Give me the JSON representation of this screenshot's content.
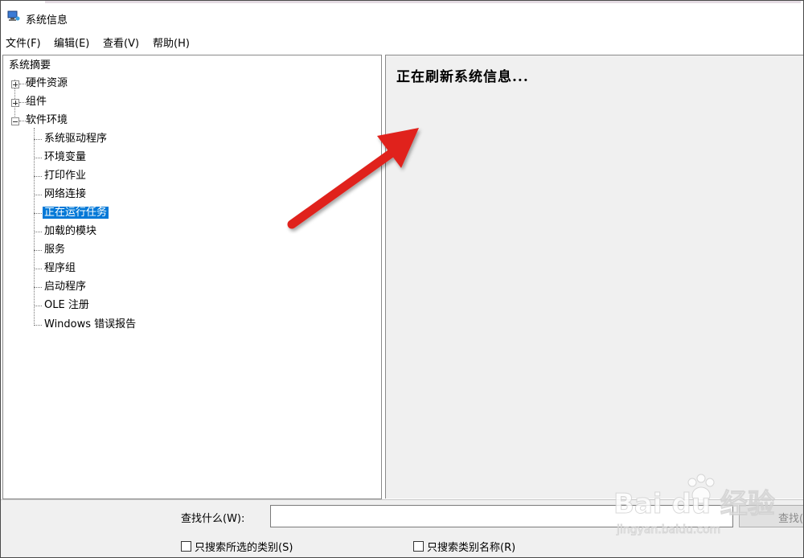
{
  "window": {
    "title": "系统信息"
  },
  "menu": [
    "文件(F)",
    "编辑(E)",
    "查看(V)",
    "帮助(H)"
  ],
  "tree": {
    "root": "系统摘要",
    "nodes": [
      {
        "label": "硬件资源",
        "state": "collapsed"
      },
      {
        "label": "组件",
        "state": "collapsed"
      },
      {
        "label": "软件环境",
        "state": "expanded"
      }
    ],
    "software_children": [
      "系统驱动程序",
      "环境变量",
      "打印作业",
      "网络连接",
      "正在运行任务",
      "加载的模块",
      "服务",
      "程序组",
      "启动程序",
      "OLE 注册",
      "Windows 错误报告"
    ],
    "selected": "正在运行任务"
  },
  "content": {
    "status": "正在刷新系统信息..."
  },
  "search": {
    "label": "查找什么(W):",
    "value": "",
    "find_button": "查找(",
    "checkbox_selected_category": "只搜索所选的类别(S)",
    "checkbox_category_names": "只搜索类别名称(R)"
  },
  "watermark": {
    "brand": "Bai du 经验",
    "url": "jingyan.baidu.com"
  },
  "colors": {
    "selection": "#0078d7",
    "arrow": "#e0201b",
    "pane_bg": "#f0f0f0"
  }
}
